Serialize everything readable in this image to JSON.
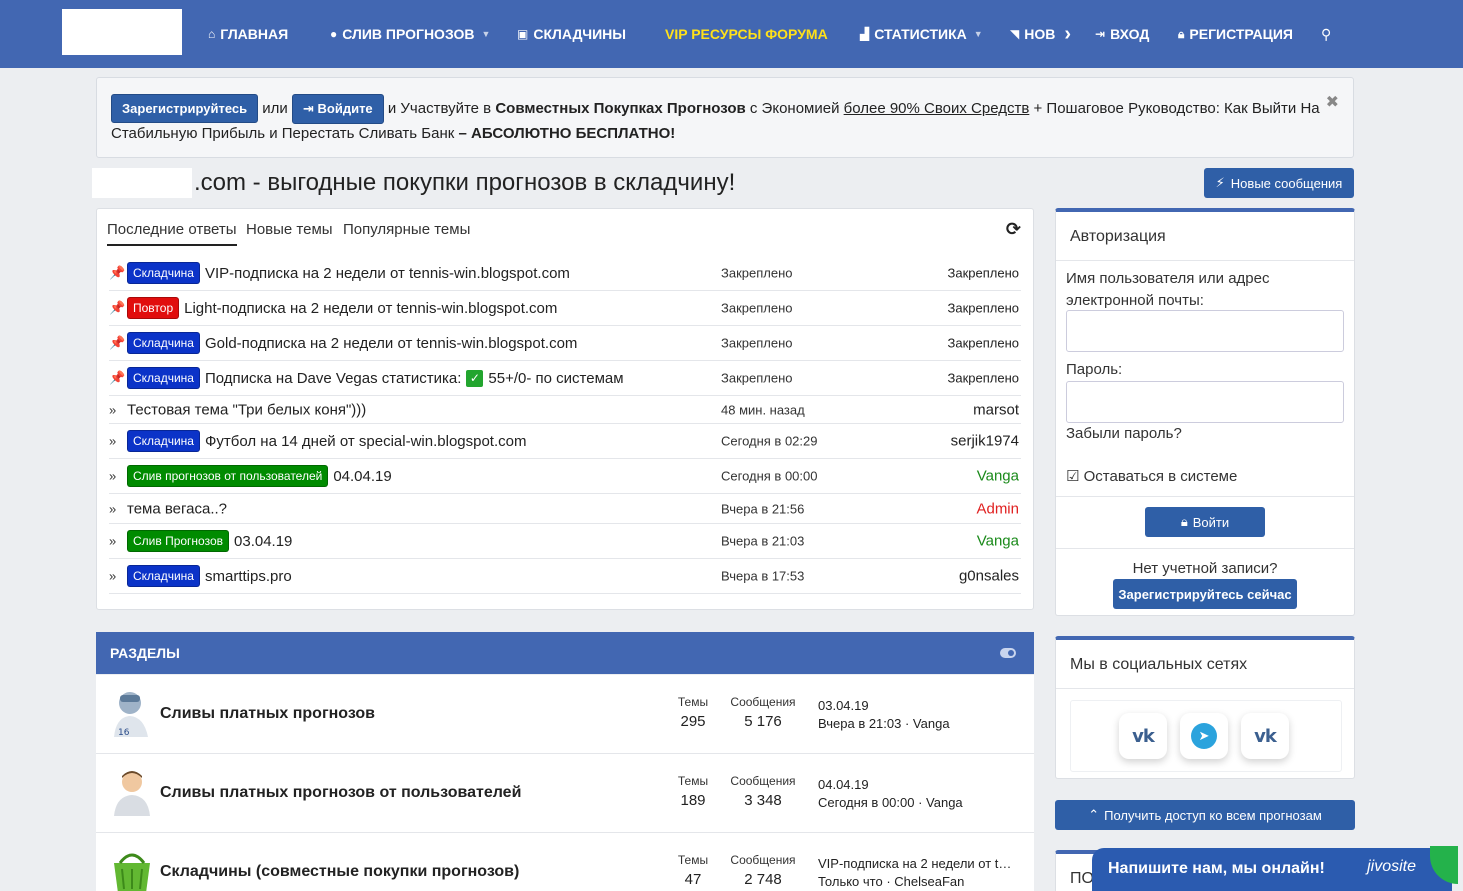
{
  "nav": {
    "items": [
      {
        "label": "ГЛАВНАЯ",
        "icon": "home-icon"
      },
      {
        "label": "СЛИВ ПРОГНОЗОВ",
        "icon": "comment-icon"
      },
      {
        "label": "СКЛАДЧИНЫ",
        "icon": "car-icon"
      },
      {
        "label": "VIP РЕСУРСЫ ФОРУМА"
      },
      {
        "label": "СТАТИСТИКА",
        "icon": "chart-icon"
      },
      {
        "label": "НОВ",
        "icon": "rss-icon"
      },
      {
        "label": "ВХОД",
        "icon": "sign-in-icon"
      },
      {
        "label": "РЕГИСТРАЦИЯ",
        "icon": "lock-icon"
      }
    ]
  },
  "notice": {
    "register_label": "Зарегистрируйтесь",
    "or": "или",
    "login_label": "Войдите",
    "text1": "и Участвуйте в",
    "bold1": "Совместных Покупках Прогнозов",
    "text2": "с Экономией",
    "underline": "более 90% Своих Средств",
    "text3": "+ Пошаговое Руководство: Как Выйти На",
    "text4": "Стабильную Прибыль и Перестать Сливать Банк",
    "bold2": "– АБСОЛЮТНО БЕСПЛАТНО!"
  },
  "headline": ".com - выгодные покупки прогнозов в складчину!",
  "new_messages_label": "Новые сообщения",
  "threads": {
    "tabs": [
      "Последние ответы",
      "Новые темы",
      "Популярные темы"
    ],
    "rows": [
      {
        "marker": "📌",
        "badge": "Складчина",
        "badge_color": "blue",
        "title": "VIP-подписка на 2 недели от tennis-win.blogspot.com",
        "when": "Закреплено",
        "who": "Закреплено"
      },
      {
        "marker": "📌",
        "badge": "Повтор",
        "badge_color": "red",
        "title": "Light-подписка на 2 недели от tennis-win.blogspot.com",
        "when": "Закреплено",
        "who": "Закреплено"
      },
      {
        "marker": "📌",
        "badge": "Складчина",
        "badge_color": "blue",
        "title": "Gold-подписка на 2 недели от tennis-win.blogspot.com",
        "when": "Закреплено",
        "who": "Закреплено"
      },
      {
        "marker": "📌",
        "badge": "Складчина",
        "badge_color": "blue",
        "title": "Подписка на Dave Vegas статистика:",
        "title_suffix": "55+/0- по системам",
        "when": "Закреплено",
        "who": "Закреплено"
      },
      {
        "marker": "»",
        "badge": "",
        "title": "Тестовая тема \"Три белых коня\")))",
        "when": "48 мин. назад",
        "who": "marsot"
      },
      {
        "marker": "»",
        "badge": "Складчина",
        "badge_color": "blue",
        "title": "Футбол на 14 дней от special-win.blogspot.com",
        "when": "Сегодня в 02:29",
        "who": "serjik1974"
      },
      {
        "marker": "»",
        "badge": "Слив прогнозов от пользователей",
        "badge_color": "green",
        "title": "04.04.19",
        "when": "Сегодня в 00:00",
        "who": "Vanga",
        "who_color": "green"
      },
      {
        "marker": "»",
        "badge": "",
        "title": "тема вегаса..?",
        "when": "Вчера в 21:56",
        "who": "Admin",
        "who_color": "red"
      },
      {
        "marker": "»",
        "badge": "Слив Прогнозов",
        "badge_color": "green",
        "title": "03.04.19",
        "when": "Вчера в 21:03",
        "who": "Vanga",
        "who_color": "green"
      },
      {
        "marker": "»",
        "badge": "Складчина",
        "badge_color": "blue",
        "title": "smarttips.pro",
        "when": "Вчера в 17:53",
        "who": "g0nsales"
      }
    ]
  },
  "sections": {
    "title": "РАЗДЕЛЫ",
    "forums": [
      {
        "name": "Сливы платных прогнозов",
        "threads_label": "Темы",
        "threads": "295",
        "posts_label": "Сообщения",
        "posts": "5 176",
        "last1": "03.04.19",
        "last2": "Вчера в 21:03 · Vanga",
        "icon": "football-player-icon"
      },
      {
        "name": "Сливы платных прогнозов от пользователей",
        "threads_label": "Темы",
        "threads": "189",
        "posts_label": "Сообщения",
        "posts": "3 348",
        "last1": "04.04.19",
        "last2": "Сегодня в 00:00 · Vanga",
        "icon": "user-avatar-icon"
      },
      {
        "name": "Складчины (совместные покупки прогнозов)",
        "threads_label": "Темы",
        "threads": "47",
        "posts_label": "Сообщения",
        "posts": "2 748",
        "last1": "VIP-подписка на 2 недели от t…",
        "last2": "Только что · ChelseaFan",
        "icon": "basket-icon"
      }
    ]
  },
  "auth": {
    "title": "Авторизация",
    "username_label": "Имя пользователя или адрес электронной почты:",
    "password_label": "Пароль:",
    "forgot": "Забыли пароль?",
    "remember": "Оставаться в системе",
    "login_button": "Войти",
    "no_account": "Нет учетной записи?",
    "register_button": "Зарегистрируйтесь сейчас"
  },
  "social": {
    "title": "Мы в социальных сетях",
    "buttons": [
      {
        "icon": "vk-icon",
        "text": "vk"
      },
      {
        "icon": "telegram-icon",
        "text": "➤"
      },
      {
        "icon": "vk-icon",
        "text": "vk"
      }
    ]
  },
  "access_button": "Получить доступ ко всем прогнозам",
  "bottom_panel_title": "ПО",
  "jivo": {
    "text": "Напишите нам, мы онлайн!",
    "brand": "jivosite"
  }
}
